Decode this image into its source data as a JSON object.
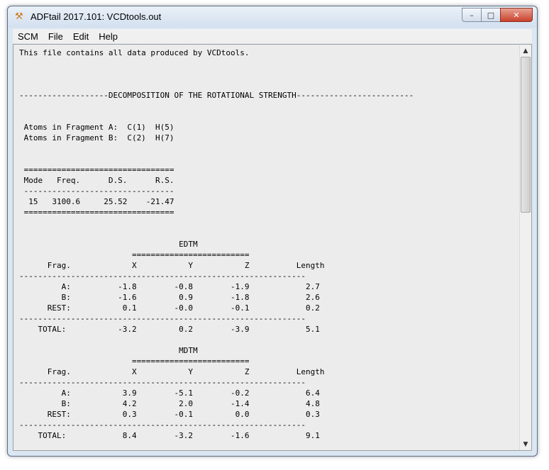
{
  "window": {
    "title": "ADFtail 2017.101: VCDtools.out",
    "minimize_glyph": "–",
    "maximize_glyph": "□",
    "close_glyph": "✕"
  },
  "menu": [
    "SCM",
    "File",
    "Edit",
    "Help"
  ],
  "content_lines": [
    "This file contains all data produced by VCDtools.",
    "",
    "",
    "",
    "-------------------DECOMPOSITION OF THE ROTATIONAL STRENGTH-------------------------",
    "",
    "",
    " Atoms in Fragment A:  C(1)  H(5)",
    " Atoms in Fragment B:  C(2)  H(7)",
    "",
    "",
    " ================================",
    " Mode   Freq.      D.S.      R.S.",
    " --------------------------------",
    "  15   3100.6     25.52    -21.47",
    " ================================",
    "",
    "",
    "                                  EDTM",
    "                        =========================",
    "      Frag.             X           Y           Z          Length",
    "-------------------------------------------------------------",
    "         A:          -1.8        -0.8        -1.9            2.7",
    "         B:          -1.6         0.9        -1.8            2.6",
    "      REST:           0.1        -0.0        -0.1            0.2",
    "-------------------------------------------------------------",
    "    TOTAL:           -3.2         0.2        -3.9            5.1",
    "",
    "                                  MDTM",
    "                        =========================",
    "      Frag.             X           Y           Z          Length",
    "-------------------------------------------------------------",
    "         A:           3.9        -5.1        -0.2            6.4",
    "         B:           4.2         2.0        -1.4            4.8",
    "      REST:           0.3        -0.1         0.0            0.3",
    "-------------------------------------------------------------",
    "    TOTAL:            8.4        -3.2        -1.6            9.1"
  ],
  "scrollbar": {
    "up_glyph": "▲",
    "down_glyph": "▼"
  }
}
